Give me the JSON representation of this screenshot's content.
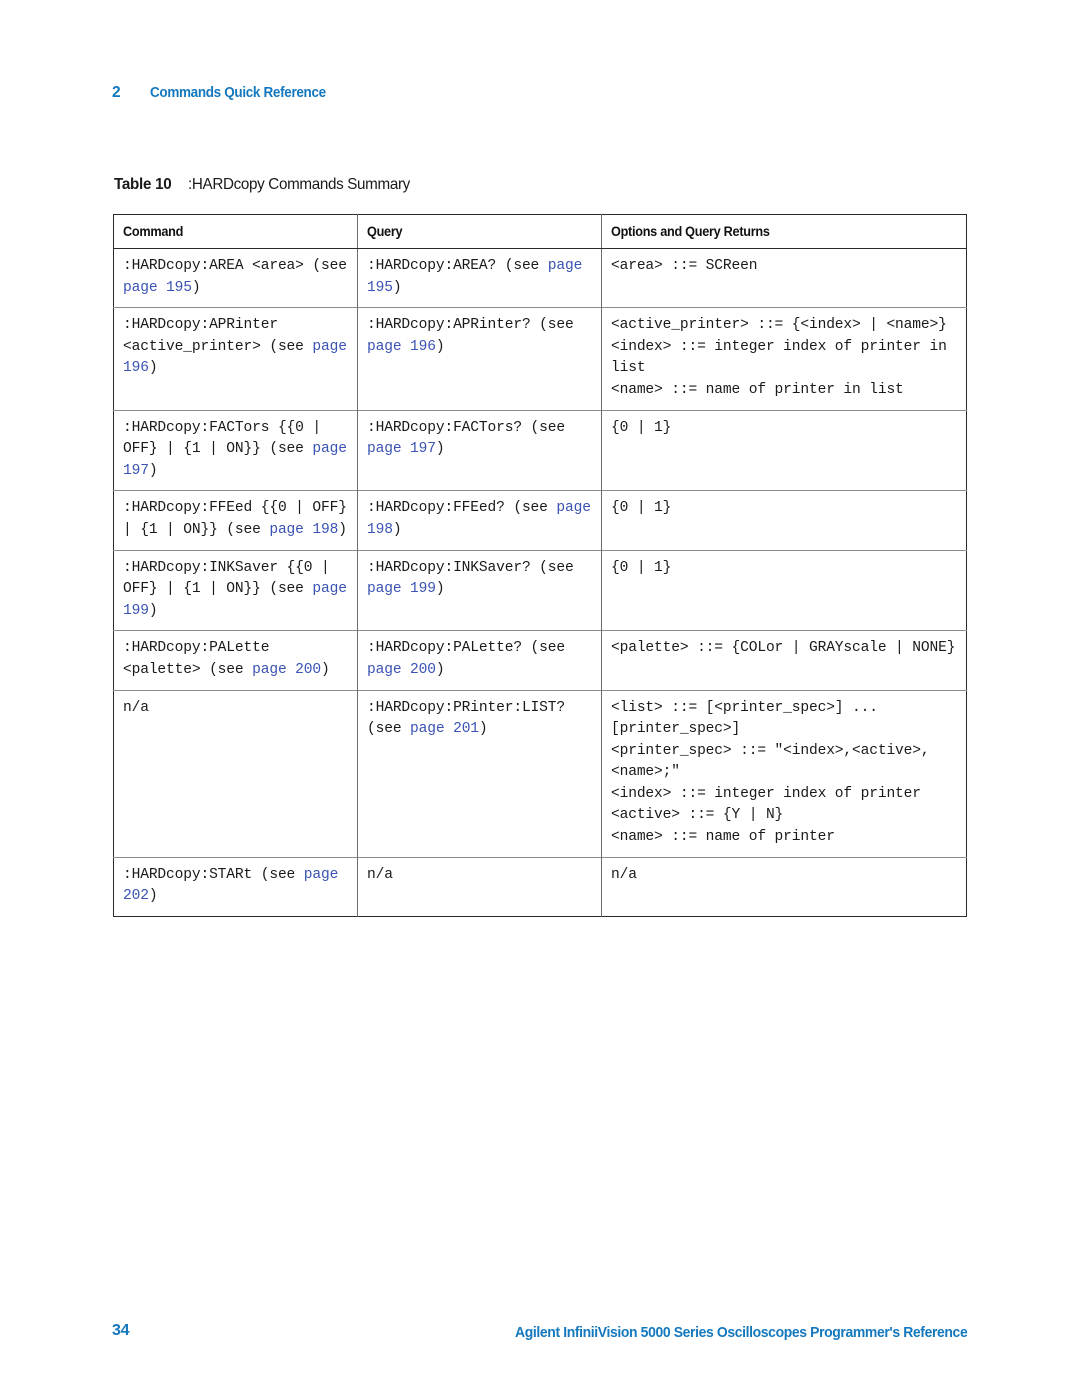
{
  "page": {
    "chapter_number": "2",
    "chapter_title": "Commands Quick Reference",
    "footer_page_number": "34",
    "footer_doc_title": "Agilent InfiniiVision 5000 Series Oscilloscopes Programmer's Reference",
    "accent_color": "#1478be",
    "link_color": "#3a53b4",
    "border_color": "#2b2b2b",
    "row_rule_color": "#8c8c8c"
  },
  "table": {
    "caption_label": "Table 10",
    "caption_text": ":HARDcopy Commands Summary",
    "columns": [
      "Command",
      "Query",
      "Options and Query Returns"
    ],
    "rows": [
      {
        "command": [
          {
            "t": ":HARDcopy:AREA <area> "
          },
          {
            "t": "(see "
          },
          {
            "t": "page 195",
            "link": true
          },
          {
            "t": ")"
          }
        ],
        "query": [
          {
            "t": ":HARDcopy:AREA? (see "
          },
          {
            "t": "page 195",
            "link": true
          },
          {
            "t": ")"
          }
        ],
        "options": [
          {
            "t": "<area> ::= SCReen"
          }
        ]
      },
      {
        "command": [
          {
            "t": ":HARDcopy:APRinter "
          },
          {
            "t": "<active_printer> (see "
          },
          {
            "t": "page 196",
            "link": true
          },
          {
            "t": ")"
          }
        ],
        "query": [
          {
            "t": ":HARDcopy:APRinter? "
          },
          {
            "t": "(see "
          },
          {
            "t": "page 196",
            "link": true
          },
          {
            "t": ")"
          }
        ],
        "options": [
          {
            "t": "<active_printer> ::= {<index> | <name>}\n<index> ::= integer index of printer in list\n<name> ::= name of printer in list"
          }
        ]
      },
      {
        "command": [
          {
            "t": ":HARDcopy:FACTors {{0 | OFF} | {1 | ON}} "
          },
          {
            "t": "(see "
          },
          {
            "t": "page 197",
            "link": true
          },
          {
            "t": ")"
          }
        ],
        "query": [
          {
            "t": ":HARDcopy:FACTors? "
          },
          {
            "t": "(see "
          },
          {
            "t": "page 197",
            "link": true
          },
          {
            "t": ")"
          }
        ],
        "options": [
          {
            "t": "{0 | 1}"
          }
        ]
      },
      {
        "command": [
          {
            "t": ":HARDcopy:FFEed {{0 | OFF} | {1 | ON}} (see "
          },
          {
            "t": "page 198",
            "link": true
          },
          {
            "t": ")"
          }
        ],
        "query": [
          {
            "t": ":HARDcopy:FFEed? (see "
          },
          {
            "t": "page 198",
            "link": true
          },
          {
            "t": ")"
          }
        ],
        "options": [
          {
            "t": "{0 | 1}"
          }
        ]
      },
      {
        "command": [
          {
            "t": ":HARDcopy:INKSaver "
          },
          {
            "t": "{{0 | OFF} | {1 | ON}} (see "
          },
          {
            "t": "page 199",
            "link": true
          },
          {
            "t": ")"
          }
        ],
        "query": [
          {
            "t": ":HARDcopy:INKSaver? "
          },
          {
            "t": "(see "
          },
          {
            "t": "page 199",
            "link": true
          },
          {
            "t": ")"
          }
        ],
        "options": [
          {
            "t": "{0 | 1}"
          }
        ]
      },
      {
        "command": [
          {
            "t": ":HARDcopy:PALette "
          },
          {
            "t": "<palette> (see "
          },
          {
            "t": "page 200",
            "link": true
          },
          {
            "t": ")"
          }
        ],
        "query": [
          {
            "t": ":HARDcopy:PALette? "
          },
          {
            "t": "(see "
          },
          {
            "t": "page 200",
            "link": true
          },
          {
            "t": ")"
          }
        ],
        "options": [
          {
            "t": "<palette> ::= {COLor | GRAYscale | NONE}"
          }
        ]
      },
      {
        "command": [
          {
            "t": "n/a"
          }
        ],
        "query": [
          {
            "t": ":HARDcopy:PRinter:LIST? (see "
          },
          {
            "t": "page 201",
            "link": true
          },
          {
            "t": ")"
          }
        ],
        "options": [
          {
            "t": "<list> ::= [<printer_spec>] ... [printer_spec>]\n<printer_spec> ::= \"<index>,<active>,<name>;\"\n<index> ::= integer index of printer\n<active> ::= {Y | N}\n<name> ::= name of printer"
          }
        ]
      },
      {
        "command": [
          {
            "t": ":HARDcopy:STARt (see "
          },
          {
            "t": "page 202",
            "link": true
          },
          {
            "t": ")"
          }
        ],
        "query": [
          {
            "t": "n/a"
          }
        ],
        "options": [
          {
            "t": "n/a"
          }
        ]
      }
    ]
  }
}
